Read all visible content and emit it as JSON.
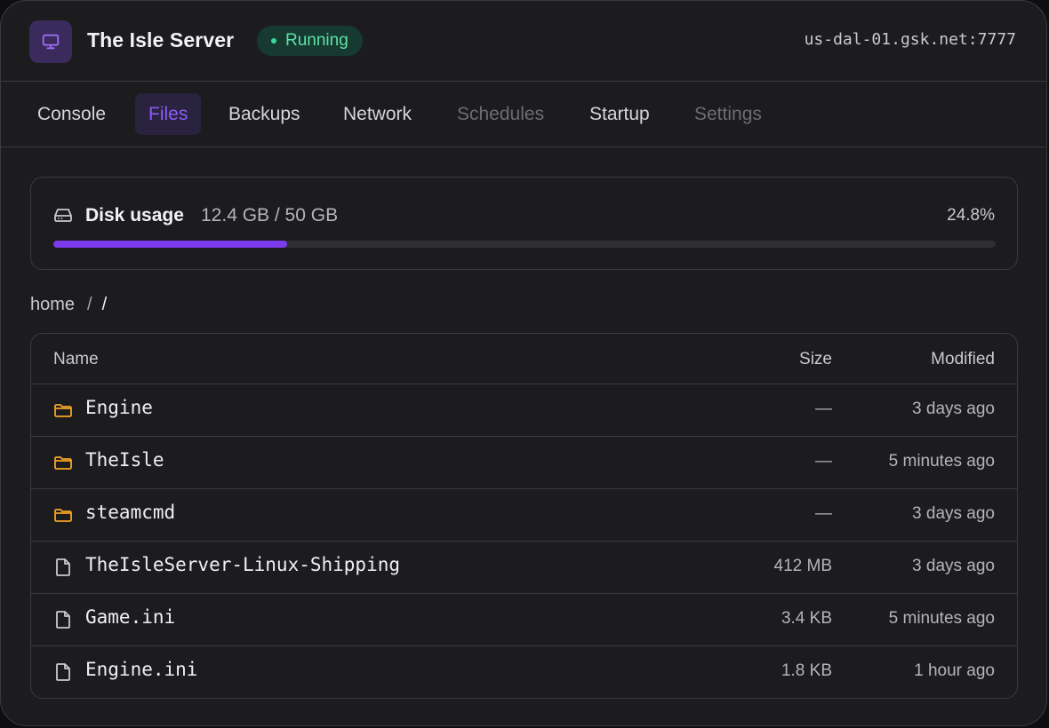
{
  "colors": {
    "accent": "#7c3aed",
    "status_green": "#3fd89a",
    "folder_orange": "#f5a524"
  },
  "header": {
    "icon": "monitor-icon",
    "title": "The Isle Server",
    "status": "Running",
    "address": "us-dal-01.gsk.net:7777"
  },
  "tabs": [
    {
      "label": "Console",
      "state": "normal"
    },
    {
      "label": "Files",
      "state": "active"
    },
    {
      "label": "Backups",
      "state": "normal"
    },
    {
      "label": "Network",
      "state": "normal"
    },
    {
      "label": "Schedules",
      "state": "disabled"
    },
    {
      "label": "Startup",
      "state": "normal"
    },
    {
      "label": "Settings",
      "state": "disabled"
    }
  ],
  "disk": {
    "icon": "hard-drive-icon",
    "label": "Disk usage",
    "value": "12.4 GB / 50 GB",
    "percent_text": "24.8%",
    "fraction": 0.248
  },
  "breadcrumb": {
    "root": "home",
    "separator": "/",
    "current": "/"
  },
  "files": {
    "columns": {
      "name": "Name",
      "size": "Size",
      "modified": "Modified"
    },
    "rows": [
      {
        "type": "folder",
        "icon": "folder-icon",
        "name": "Engine",
        "size": "—",
        "modified": "3 days ago"
      },
      {
        "type": "folder",
        "icon": "folder-icon",
        "name": "TheIsle",
        "size": "—",
        "modified": "5 minutes ago"
      },
      {
        "type": "folder",
        "icon": "folder-icon",
        "name": "steamcmd",
        "size": "—",
        "modified": "3 days ago"
      },
      {
        "type": "file",
        "icon": "file-icon",
        "name": "TheIsleServer-Linux-Shipping",
        "size": "412 MB",
        "modified": "3 days ago"
      },
      {
        "type": "file",
        "icon": "file-icon",
        "name": "Game.ini",
        "size": "3.4 KB",
        "modified": "5 minutes ago"
      },
      {
        "type": "file",
        "icon": "file-icon",
        "name": "Engine.ini",
        "size": "1.8 KB",
        "modified": "1 hour ago"
      }
    ]
  }
}
